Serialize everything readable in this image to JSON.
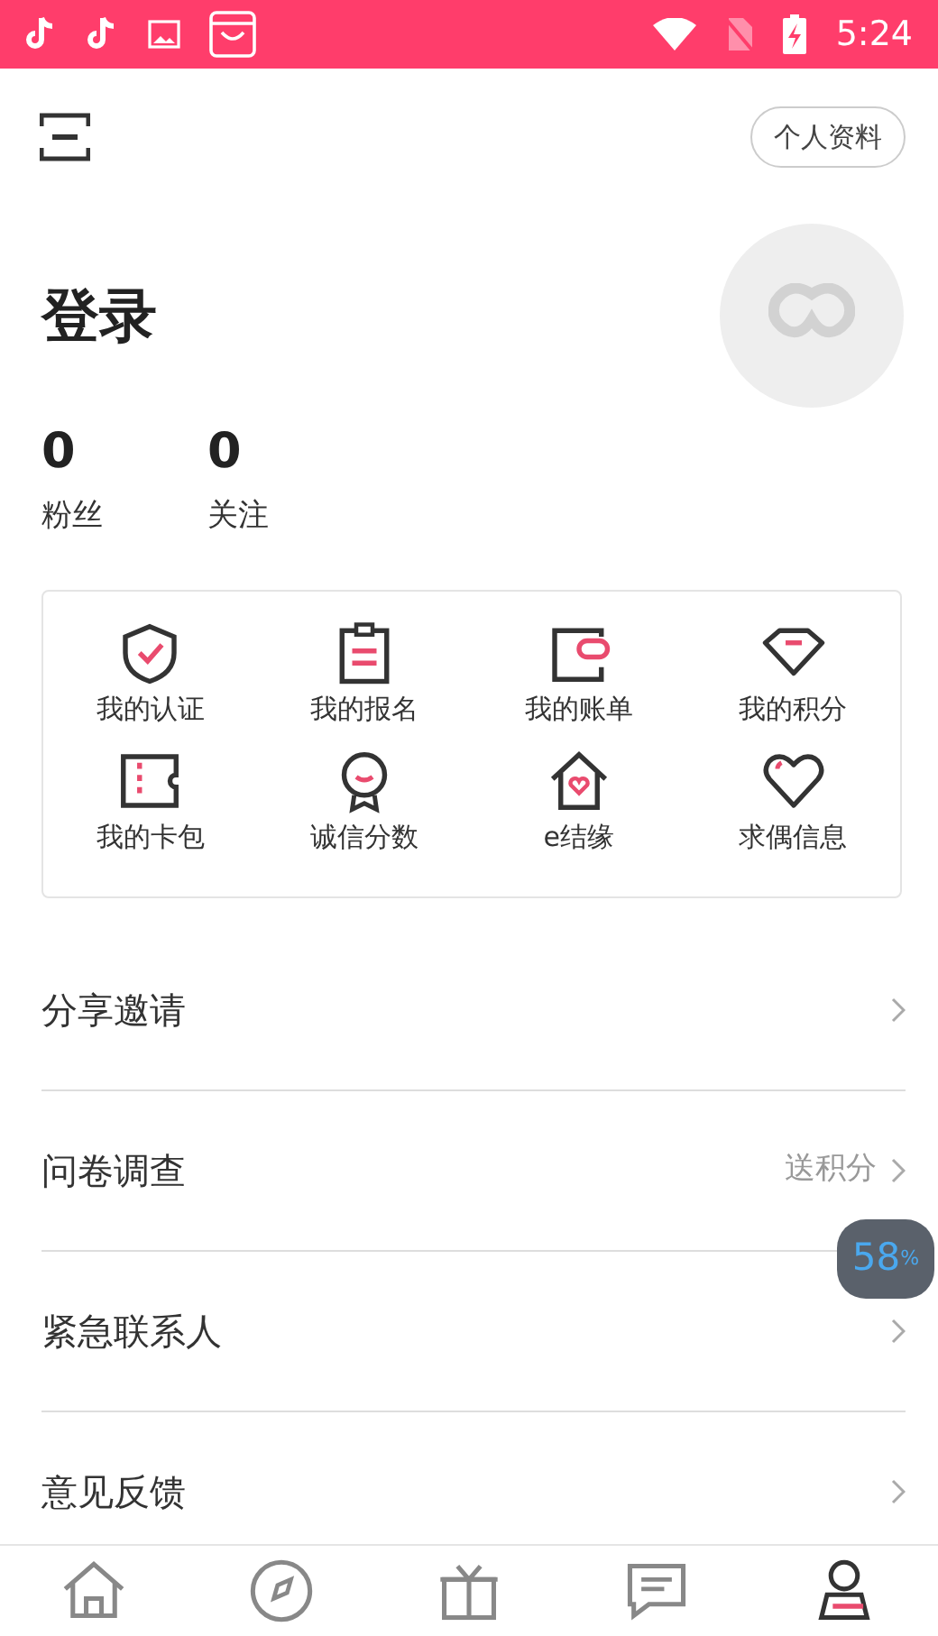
{
  "status_bar": {
    "time": "5:24"
  },
  "header": {
    "profile_button": "个人资料"
  },
  "user": {
    "name": "登录",
    "stats": [
      {
        "value": "0",
        "label": "粉丝"
      },
      {
        "value": "0",
        "label": "关注"
      }
    ]
  },
  "features": [
    {
      "kind": "shield",
      "label": "我的认证"
    },
    {
      "kind": "clipboard",
      "label": "我的报名"
    },
    {
      "kind": "wallet",
      "label": "我的账单"
    },
    {
      "kind": "diamond",
      "label": "我的积分"
    },
    {
      "kind": "ticket",
      "label": "我的卡包"
    },
    {
      "kind": "medal",
      "label": "诚信分数"
    },
    {
      "kind": "house",
      "label": "e结缘"
    },
    {
      "kind": "heart",
      "label": "求偶信息"
    }
  ],
  "menu": [
    {
      "label": "分享邀请"
    },
    {
      "label": "问卷调查",
      "hint": "送积分"
    },
    {
      "label": "紧急联系人"
    },
    {
      "label": "意见反馈"
    }
  ],
  "overlay": {
    "value": "58",
    "unit": "%"
  },
  "tabs": [
    {
      "kind": "home",
      "selected": false
    },
    {
      "kind": "compass",
      "selected": false
    },
    {
      "kind": "gift",
      "selected": false
    },
    {
      "kind": "chat",
      "selected": false
    },
    {
      "kind": "person",
      "selected": true
    }
  ]
}
